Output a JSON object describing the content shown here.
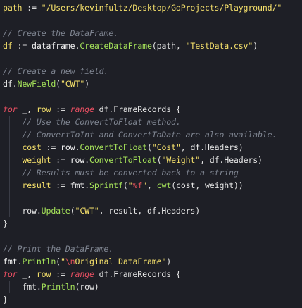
{
  "editor": {
    "lines": [
      [
        {
          "t": "path",
          "c": "var"
        },
        {
          "t": " := ",
          "c": "op"
        },
        {
          "t": "\"/Users/kevinfultz/Desktop/GoProjects/Playground/\"",
          "c": "str"
        }
      ],
      [],
      [
        {
          "t": "// Create the DataFrame.",
          "c": "cmt"
        }
      ],
      [
        {
          "t": "df",
          "c": "var"
        },
        {
          "t": " := ",
          "c": "op"
        },
        {
          "t": "dataframe",
          "c": "id"
        },
        {
          "t": ".",
          "c": "pun"
        },
        {
          "t": "CreateDataFrame",
          "c": "fn"
        },
        {
          "t": "(path, ",
          "c": "pun"
        },
        {
          "t": "\"TestData.csv\"",
          "c": "str"
        },
        {
          "t": ")",
          "c": "pun"
        }
      ],
      [],
      [
        {
          "t": "// Create a new field.",
          "c": "cmt"
        }
      ],
      [
        {
          "t": "df",
          "c": "id"
        },
        {
          "t": ".",
          "c": "pun"
        },
        {
          "t": "NewField",
          "c": "fn"
        },
        {
          "t": "(",
          "c": "pun"
        },
        {
          "t": "\"CWT\"",
          "c": "str"
        },
        {
          "t": ")",
          "c": "pun"
        }
      ],
      [],
      [
        {
          "t": "for",
          "c": "kw"
        },
        {
          "t": " _, ",
          "c": "pun"
        },
        {
          "t": "row",
          "c": "var"
        },
        {
          "t": " := ",
          "c": "op"
        },
        {
          "t": "range",
          "c": "kw"
        },
        {
          "t": " df.FrameRecords {",
          "c": "pun"
        }
      ],
      [
        {
          "t": "    // Use the ConvertToFloat method.",
          "c": "cmt"
        }
      ],
      [
        {
          "t": "    // ConvertToInt and ConvertToDate are also available.",
          "c": "cmt"
        }
      ],
      [
        {
          "t": "    ",
          "c": "pun"
        },
        {
          "t": "cost",
          "c": "var"
        },
        {
          "t": " := ",
          "c": "op"
        },
        {
          "t": "row",
          "c": "id"
        },
        {
          "t": ".",
          "c": "pun"
        },
        {
          "t": "ConvertToFloat",
          "c": "fn"
        },
        {
          "t": "(",
          "c": "pun"
        },
        {
          "t": "\"Cost\"",
          "c": "str"
        },
        {
          "t": ", df.Headers)",
          "c": "pun"
        }
      ],
      [
        {
          "t": "    ",
          "c": "pun"
        },
        {
          "t": "weight",
          "c": "var"
        },
        {
          "t": " := ",
          "c": "op"
        },
        {
          "t": "row",
          "c": "id"
        },
        {
          "t": ".",
          "c": "pun"
        },
        {
          "t": "ConvertToFloat",
          "c": "fn"
        },
        {
          "t": "(",
          "c": "pun"
        },
        {
          "t": "\"Weight\"",
          "c": "str"
        },
        {
          "t": ", df.Headers)",
          "c": "pun"
        }
      ],
      [
        {
          "t": "    // Results must be converted back to a string",
          "c": "cmt"
        }
      ],
      [
        {
          "t": "    ",
          "c": "pun"
        },
        {
          "t": "result",
          "c": "var"
        },
        {
          "t": " := ",
          "c": "op"
        },
        {
          "t": "fmt",
          "c": "id"
        },
        {
          "t": ".",
          "c": "pun"
        },
        {
          "t": "Sprintf",
          "c": "fn"
        },
        {
          "t": "(",
          "c": "pun"
        },
        {
          "t": "\"",
          "c": "str"
        },
        {
          "t": "%f",
          "c": "fmt"
        },
        {
          "t": "\"",
          "c": "str"
        },
        {
          "t": ", ",
          "c": "pun"
        },
        {
          "t": "cwt",
          "c": "fn"
        },
        {
          "t": "(cost, weight))",
          "c": "pun"
        }
      ],
      [],
      [
        {
          "t": "    row",
          "c": "pun"
        },
        {
          "t": ".",
          "c": "pun"
        },
        {
          "t": "Update",
          "c": "fn"
        },
        {
          "t": "(",
          "c": "pun"
        },
        {
          "t": "\"CWT\"",
          "c": "str"
        },
        {
          "t": ", result, df.Headers)",
          "c": "pun"
        }
      ],
      [
        {
          "t": "}",
          "c": "pun"
        }
      ],
      [],
      [
        {
          "t": "// Print the DataFrame.",
          "c": "cmt"
        }
      ],
      [
        {
          "t": "fmt",
          "c": "id"
        },
        {
          "t": ".",
          "c": "pun"
        },
        {
          "t": "Println",
          "c": "fn"
        },
        {
          "t": "(",
          "c": "pun"
        },
        {
          "t": "\"",
          "c": "str"
        },
        {
          "t": "\\n",
          "c": "esc"
        },
        {
          "t": "Original DataFrame\"",
          "c": "str"
        },
        {
          "t": ")",
          "c": "pun"
        }
      ],
      [
        {
          "t": "for",
          "c": "kw"
        },
        {
          "t": " _, ",
          "c": "pun"
        },
        {
          "t": "row",
          "c": "var"
        },
        {
          "t": " := ",
          "c": "op"
        },
        {
          "t": "range",
          "c": "kw"
        },
        {
          "t": " df.FrameRecords {",
          "c": "pun"
        }
      ],
      [
        {
          "t": "    fmt",
          "c": "pun"
        },
        {
          "t": ".",
          "c": "pun"
        },
        {
          "t": "Println",
          "c": "fn"
        },
        {
          "t": "(row)",
          "c": "pun"
        }
      ],
      [
        {
          "t": "}",
          "c": "pun"
        }
      ]
    ],
    "indent_guides": [
      9,
      10,
      11,
      12,
      13,
      14,
      15,
      16,
      22
    ]
  }
}
